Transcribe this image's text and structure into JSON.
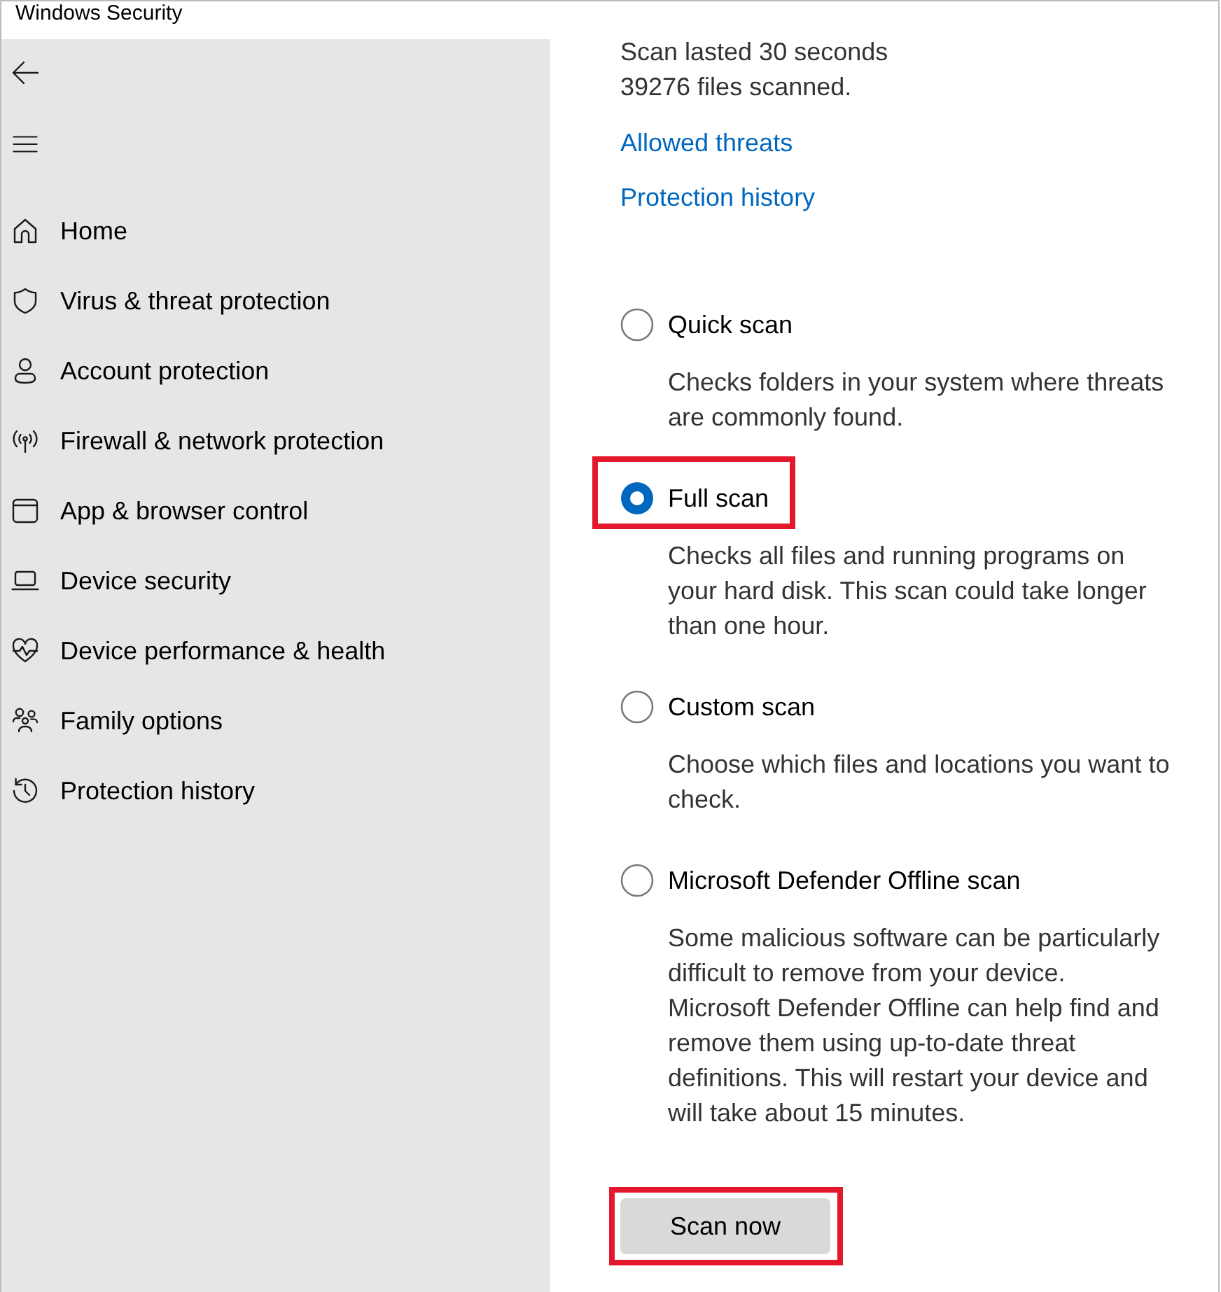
{
  "window": {
    "title": "Windows Security"
  },
  "sidebar": {
    "items": [
      {
        "label": "Home"
      },
      {
        "label": "Virus & threat protection"
      },
      {
        "label": "Account protection"
      },
      {
        "label": "Firewall & network protection"
      },
      {
        "label": "App & browser control"
      },
      {
        "label": "Device security"
      },
      {
        "label": "Device performance & health"
      },
      {
        "label": "Family options"
      },
      {
        "label": "Protection history"
      }
    ]
  },
  "scan_summary": [
    "Scan lasted 30 seconds",
    "39276 files scanned."
  ],
  "links": [
    "Allowed threats",
    "Protection history"
  ],
  "scan_options": [
    {
      "label": "Quick scan",
      "description": "Checks folders in your system where threats are commonly found.",
      "selected": false,
      "highlighted": false
    },
    {
      "label": "Full scan",
      "description": "Checks all files and running programs on your hard disk. This scan could take longer than one hour.",
      "selected": true,
      "highlighted": true
    },
    {
      "label": "Custom scan",
      "description": "Choose which files and locations you want to check.",
      "selected": false,
      "highlighted": false
    },
    {
      "label": "Microsoft Defender Offline scan",
      "description": "Some malicious software can be particularly difficult to remove from your device. Microsoft Defender Offline can help find and remove them using up-to-date threat definitions. This will restart your device and will take about 15 minutes.",
      "selected": false,
      "highlighted": false
    }
  ],
  "scan_button": {
    "label": "Scan now",
    "highlighted": true
  }
}
